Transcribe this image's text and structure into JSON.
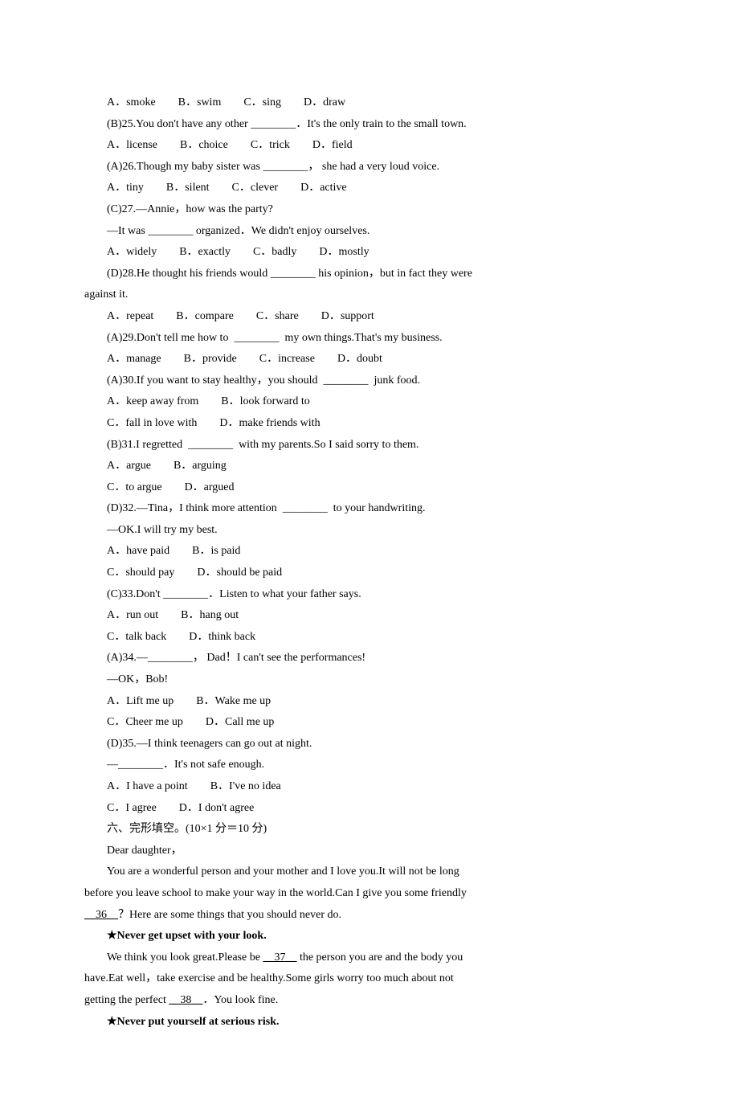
{
  "lines": [
    {
      "indent": true,
      "segments": [
        {
          "t": "A．smoke　　B．swim　　C．sing　　D．draw"
        }
      ]
    },
    {
      "indent": true,
      "segments": [
        {
          "t": "(B)25.You don't have any other ________．It's the only train to the small town."
        }
      ]
    },
    {
      "indent": true,
      "segments": [
        {
          "t": "A．license　　B．choice　　C．trick　　D．field"
        }
      ]
    },
    {
      "indent": true,
      "segments": [
        {
          "t": "(A)26.Though my baby sister was ________， she had a very loud voice."
        }
      ]
    },
    {
      "indent": true,
      "segments": [
        {
          "t": "A．tiny　　B．silent　　C．clever　　D．active"
        }
      ]
    },
    {
      "indent": true,
      "segments": [
        {
          "t": "(C)27.—Annie，how was the party?"
        }
      ]
    },
    {
      "indent": true,
      "segments": [
        {
          "t": "—It was ________ organized．We didn't enjoy ourselves."
        }
      ]
    },
    {
      "indent": true,
      "segments": [
        {
          "t": "A．widely　　B．exactly　　C．badly　　D．mostly"
        }
      ]
    },
    {
      "indent": true,
      "segments": [
        {
          "t": "(D)28.He thought his friends would ________ his opinion，but in fact they were"
        }
      ]
    },
    {
      "indent": false,
      "segments": [
        {
          "t": "against it."
        }
      ]
    },
    {
      "indent": true,
      "segments": [
        {
          "t": "A．repeat　　B．compare　　C．share　　D．support"
        }
      ]
    },
    {
      "indent": true,
      "segments": [
        {
          "t": "(A)29.Don't tell me how to  ________  my own things.That's my business."
        }
      ]
    },
    {
      "indent": true,
      "segments": [
        {
          "t": "A．manage　　B．provide　　C．increase　　D．doubt"
        }
      ]
    },
    {
      "indent": true,
      "segments": [
        {
          "t": "(A)30.If you want to stay healthy，you should  ________  junk food."
        }
      ]
    },
    {
      "indent": true,
      "segments": [
        {
          "t": "A．keep away from　　B．look forward to"
        }
      ]
    },
    {
      "indent": true,
      "segments": [
        {
          "t": "C．fall in love with　　D．make friends with"
        }
      ]
    },
    {
      "indent": true,
      "segments": [
        {
          "t": "(B)31.I regretted  ________  with my parents.So I said sorry to them."
        }
      ]
    },
    {
      "indent": true,
      "segments": [
        {
          "t": "A．argue　　B．arguing"
        }
      ]
    },
    {
      "indent": true,
      "segments": [
        {
          "t": "C．to argue　　D．argued"
        }
      ]
    },
    {
      "indent": true,
      "segments": [
        {
          "t": "(D)32.—Tina，I think more attention  ________  to your handwriting."
        }
      ]
    },
    {
      "indent": true,
      "segments": [
        {
          "t": "—OK.I will try my best."
        }
      ]
    },
    {
      "indent": true,
      "segments": [
        {
          "t": "A．have paid　　B．is paid"
        }
      ]
    },
    {
      "indent": true,
      "segments": [
        {
          "t": "C．should pay　　D．should be paid"
        }
      ]
    },
    {
      "indent": true,
      "segments": [
        {
          "t": "(C)33.Don't ________．Listen to what your father says."
        }
      ]
    },
    {
      "indent": true,
      "segments": [
        {
          "t": "A．run out　　B．hang out"
        }
      ]
    },
    {
      "indent": true,
      "segments": [
        {
          "t": "C．talk back　　D．think back"
        }
      ]
    },
    {
      "indent": true,
      "segments": [
        {
          "t": "(A)34.—________， Dad！I can't see the performances!"
        }
      ]
    },
    {
      "indent": true,
      "segments": [
        {
          "t": "—OK，Bob!"
        }
      ]
    },
    {
      "indent": true,
      "segments": [
        {
          "t": "A．Lift me up　　B．Wake me up"
        }
      ]
    },
    {
      "indent": true,
      "segments": [
        {
          "t": "C．Cheer me up　　D．Call me up"
        }
      ]
    },
    {
      "indent": true,
      "segments": [
        {
          "t": "(D)35.—I think teenagers can go out at night."
        }
      ]
    },
    {
      "indent": true,
      "segments": [
        {
          "t": "—________．It's not safe enough."
        }
      ]
    },
    {
      "indent": true,
      "segments": [
        {
          "t": "A．I have a point　　B．I've no idea"
        }
      ]
    },
    {
      "indent": true,
      "segments": [
        {
          "t": "C．I agree　　D．I don't agree"
        }
      ]
    },
    {
      "indent": true,
      "segments": [
        {
          "t": "六、完形填空。(10×1 分＝10 分)"
        }
      ]
    },
    {
      "indent": true,
      "segments": [
        {
          "t": "Dear daughter，"
        }
      ]
    },
    {
      "indent": true,
      "segments": [
        {
          "t": "You are a wonderful person and your mother and I love you.It will not be long"
        }
      ]
    },
    {
      "indent": false,
      "segments": [
        {
          "t": "before you leave school to make your way in the world.Can I give you some friendly"
        }
      ]
    },
    {
      "indent": false,
      "segments": [
        {
          "t": "__",
          "u": true
        },
        {
          "t": "36",
          "u": true
        },
        {
          "t": "__",
          "u": true
        },
        {
          "t": "？Here are some things that you should never do."
        }
      ]
    },
    {
      "indent": true,
      "segments": [
        {
          "t": "★Never get upset with your look.",
          "b": true
        }
      ]
    },
    {
      "indent": true,
      "segments": [
        {
          "t": "We think you look great.Please be "
        },
        {
          "t": "__",
          "u": true
        },
        {
          "t": "37",
          "u": true
        },
        {
          "t": "__",
          "u": true
        },
        {
          "t": " the person you are and the body you"
        }
      ]
    },
    {
      "indent": false,
      "segments": [
        {
          "t": "have.Eat well，take exercise and be healthy.Some girls worry too much about not"
        }
      ]
    },
    {
      "indent": false,
      "segments": [
        {
          "t": "getting the perfect "
        },
        {
          "t": "__",
          "u": true
        },
        {
          "t": "38",
          "u": true
        },
        {
          "t": "__",
          "u": true
        },
        {
          "t": "．You look fine."
        }
      ]
    },
    {
      "indent": true,
      "segments": [
        {
          "t": "★Never put yourself at serious risk.",
          "b": true
        }
      ]
    }
  ]
}
